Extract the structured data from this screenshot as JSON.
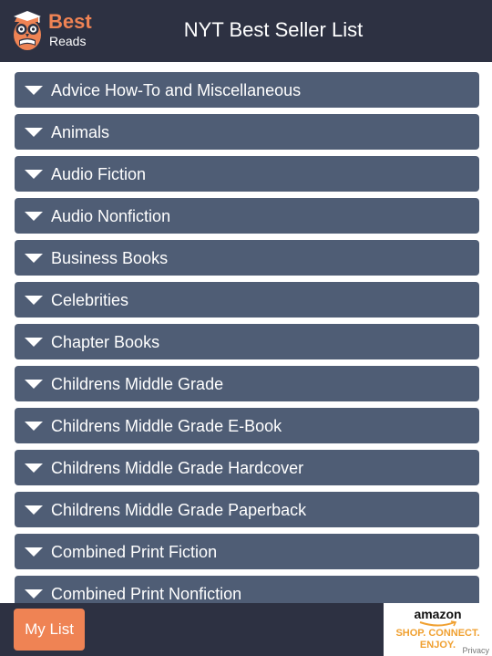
{
  "header": {
    "logo_best": "Best",
    "logo_reads": "Reads",
    "title": "NYT Best Seller List"
  },
  "categories": [
    {
      "label": "Advice How-To and Miscellaneous"
    },
    {
      "label": "Animals"
    },
    {
      "label": "Audio Fiction"
    },
    {
      "label": "Audio Nonfiction"
    },
    {
      "label": "Business Books"
    },
    {
      "label": "Celebrities"
    },
    {
      "label": "Chapter Books"
    },
    {
      "label": "Childrens Middle Grade"
    },
    {
      "label": "Childrens Middle Grade E-Book"
    },
    {
      "label": "Childrens Middle Grade Hardcover"
    },
    {
      "label": "Childrens Middle Grade Paperback"
    },
    {
      "label": "Combined Print Fiction"
    },
    {
      "label": "Combined Print Nonfiction"
    }
  ],
  "footer": {
    "my_list_label": "My List",
    "ad": {
      "brand": "amazon",
      "tagline_1": "SHOP. CONNECT.",
      "tagline_2": "ENJOY.",
      "privacy": "Privacy"
    }
  },
  "colors": {
    "header_bg": "#2d3142",
    "category_bg": "#4f5d75",
    "accent": "#ef8354"
  },
  "icons": {
    "logo": "owl-icon",
    "category_toggle": "caret-down-icon"
  }
}
